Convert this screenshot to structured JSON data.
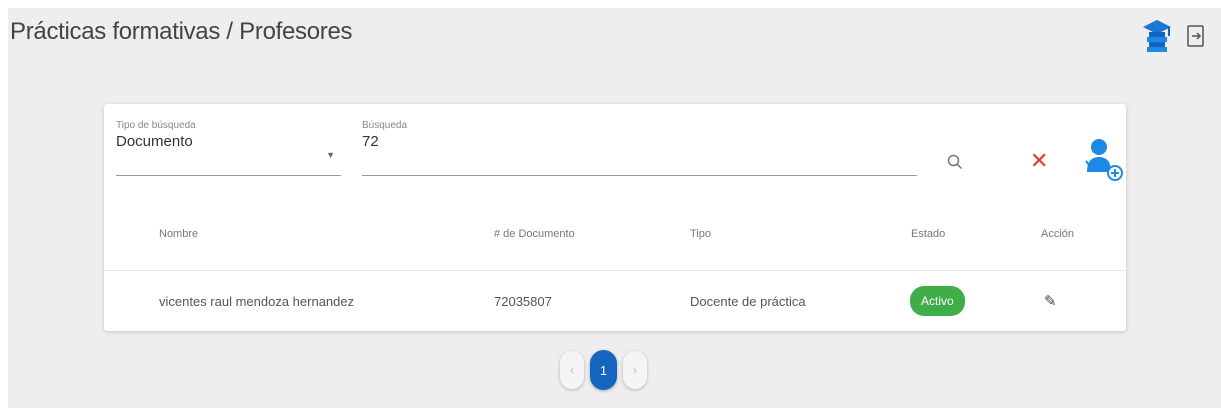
{
  "header": {
    "title": "Prácticas formativas / Profesores"
  },
  "filters": {
    "search_type": {
      "label": "Tipo de búsqueda",
      "value": "Documento"
    },
    "search_value": {
      "label": "Búsqueda",
      "value": "72"
    }
  },
  "actions": {
    "clear": "✕"
  },
  "table": {
    "columns": [
      "Nombre",
      "# de Documento",
      "Tipo",
      "Estado",
      "Acción"
    ],
    "rows": [
      {
        "name": "vicentes raul mendoza hernandez",
        "document": "72035807",
        "type": "Docente de práctica",
        "status": "Activo"
      }
    ]
  },
  "pagination": {
    "prev": "‹",
    "current": "1",
    "next": "›"
  },
  "colors": {
    "primary": "#1565c0",
    "success": "#3fae49",
    "danger": "#e53935"
  }
}
